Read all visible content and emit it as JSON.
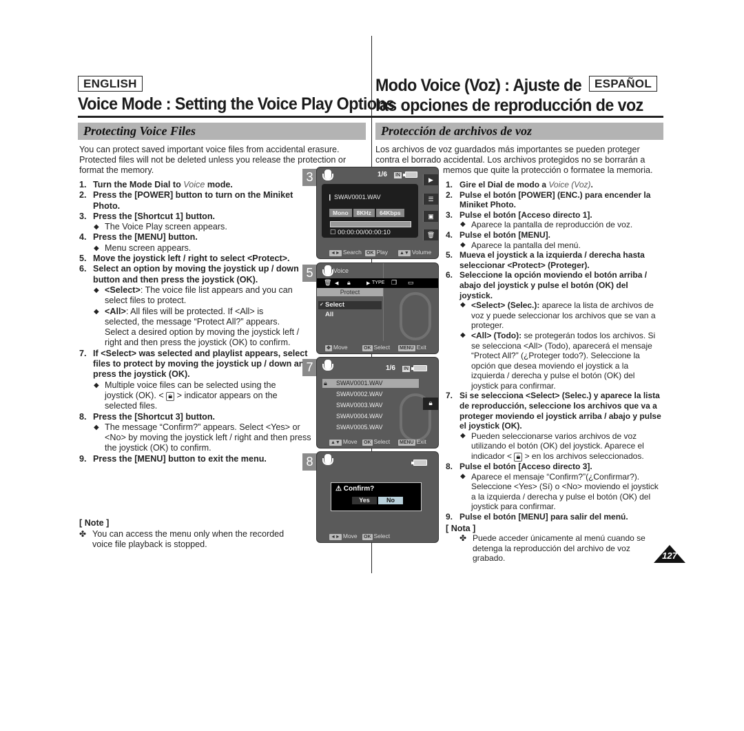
{
  "en": {
    "lang_label": "ENGLISH",
    "title": "Voice Mode : Setting the Voice Play Options",
    "section": "Protecting Voice Files",
    "intro": "You can protect saved important voice files from accidental erasure. Protected files will not be deleted unless you release the protection or format the memory.",
    "steps": [
      {
        "num": "1.",
        "text_before": "Turn the Mode Dial to ",
        "italic": "Voice",
        "text_after": " mode."
      },
      {
        "num": "2.",
        "text": "Press the [POWER] button to turn on the Miniket Photo."
      },
      {
        "num": "3.",
        "text": "Press the [Shortcut 1] button.",
        "subs": [
          "The Voice Play screen appears."
        ]
      },
      {
        "num": "4.",
        "text": "Press the [MENU] button.",
        "subs": [
          "Menu screen appears."
        ]
      },
      {
        "num": "5.",
        "text": "Move the joystick left / right to select <Protect>."
      },
      {
        "num": "6.",
        "text": "Select an option by moving the joystick up / down button and then press the joystick (OK).",
        "subs": [
          {
            "bold": "<Select>",
            "text": ": The voice file list appears and you can select files to protect."
          },
          {
            "bold": "<All>",
            "text": ": All files will be protected. If <All> is selected, the message “Protect All?” appears. Select a desired option by moving the joystick left / right and then press the joystick (OK) to confirm."
          }
        ]
      },
      {
        "num": "7.",
        "text": "If <Select> was selected and playlist appears, select files to protect by moving the joystick up / down and press the joystick (OK).",
        "subs": [
          {
            "text_before": "Multiple voice files can be selected using the joystick (OK). < ",
            "text_after": " > indicator appears on the selected files."
          }
        ]
      },
      {
        "num": "8.",
        "text": "Press the [Shortcut 3] button.",
        "subs": [
          "The message “Confirm?” appears. Select <Yes> or <No> by moving the joystick left / right and then press the joystick (OK) to confirm."
        ]
      },
      {
        "num": "9.",
        "text": "Press the [MENU] button to exit the menu."
      }
    ],
    "note_title": "[ Note ]",
    "note": "You can access the menu only when the recorded voice file playback is stopped."
  },
  "es": {
    "lang_label": "ESPAÑOL",
    "title_line1": "Modo Voice (Voz) : Ajuste de",
    "title_line2": "las opciones de reproducción de voz",
    "section": "Protección de archivos de voz",
    "intro_line1": "Los archivos de voz guardados más importantes se pueden proteger",
    "intro_line2": "contra el borrado accidental. Los archivos protegidos no se borrarán a",
    "intro_line3": "memos que quite la protección o formatee la memoria.",
    "steps": [
      {
        "num": "1.",
        "text_before": "Gire el Dial de modo a ",
        "italic": "Voice (Voz)",
        "text_after": "."
      },
      {
        "num": "2.",
        "text": "Pulse el botón [POWER] (ENC.) para encender la Miniket Photo."
      },
      {
        "num": "3.",
        "text": "Pulse el botón [Acceso directo 1].",
        "subs": [
          "Aparece la pantalla de reproducción de voz."
        ]
      },
      {
        "num": "4.",
        "text": "Pulse el botón [MENU].",
        "subs": [
          "Aparece la pantalla del menú."
        ]
      },
      {
        "num": "5.",
        "text": "Mueva el joystick a la izquierda / derecha hasta seleccionar <Protect> (Proteger)."
      },
      {
        "num": "6.",
        "text": "Seleccione la opción moviendo el botón arriba / abajo del joystick y pulse el botón (OK) del joystick.",
        "subs": [
          {
            "bold": "<Select> (Selec.):",
            "text": " aparece la lista de archivos de voz y puede seleccionar los archivos que se van a proteger."
          },
          {
            "bold": "<All> (Todo):",
            "text": " se protegerán todos los archivos. Si se selecciona <All> (Todo), aparecerá el mensaje “Protect All?” (¿Proteger todo?). Seleccione la opción que desea moviendo el joystick a la izquierda / derecha y pulse el botón (OK) del joystick para confirmar."
          }
        ]
      },
      {
        "num": "7.",
        "text": "Si se selecciona <Select> (Selec.) y aparece la lista de reproducción, seleccione los archivos que va a proteger moviendo el joystick arriba / abajo y pulse el joystick (OK).",
        "subs": [
          {
            "text_before": "Pueden seleccionarse varios archivos de voz utilizando el botón (OK) del joystick. Aparece el indicador < ",
            "text_after": " > en los archivos seleccionados."
          }
        ]
      },
      {
        "num": "8.",
        "text": "Pulse el botón [Acceso directo 3].",
        "subs": [
          "Aparece el mensaje “Confirm?”(¿Confirmar?). Seleccione <Yes> (Sí) o <No> moviendo el joystick a la izquierda / derecha y pulse el botón (OK) del joystick para confirmar."
        ]
      },
      {
        "num": "9.",
        "text": "Pulse el botón [MENU] para salir del menú."
      }
    ],
    "note_title": "[ Nota ]",
    "note": "Puede acceder únicamente al menú cuando se detenga la reproducción del archivo de voz grabado."
  },
  "screens": {
    "s3": {
      "step": "3",
      "counter": "1/6",
      "storage": "IN",
      "filename": "SWAV0001.WAV",
      "chips": [
        "Mono",
        "8KHz",
        "64Kbps"
      ],
      "progress": 0,
      "timecode": "00:00:00/00:00:10",
      "side_icons": [
        "play-icon",
        "document-icon",
        "settings-icon",
        "trash-icon"
      ],
      "footer": [
        {
          "key": "◄►",
          "label": "Search"
        },
        {
          "key": "OK",
          "label": "Play"
        },
        {
          "key": "▲▼",
          "label": "Volume"
        }
      ]
    },
    "s5": {
      "step": "5",
      "mode": "Voice",
      "menu_label": "Protect",
      "options": [
        "Select",
        "All"
      ],
      "selected": "Select",
      "footer": [
        {
          "key": "✥",
          "label": "Move"
        },
        {
          "key": "OK",
          "label": "Select"
        },
        {
          "key": "MENU",
          "label": "Exit"
        }
      ]
    },
    "s7": {
      "step": "7",
      "counter": "1/6",
      "storage": "IN",
      "files": [
        "SWAV0001.WAV",
        "SWAV0002.WAV",
        "SWAV0003.WAV",
        "SWAV0004.WAV",
        "SWAV0005.WAV"
      ],
      "footer": [
        {
          "key": "▲▼",
          "label": "Move"
        },
        {
          "key": "OK",
          "label": "Select"
        },
        {
          "key": "MENU",
          "label": "Exit"
        }
      ]
    },
    "s8": {
      "step": "8",
      "dialog_title": "Confirm?",
      "yes": "Yes",
      "no": "No",
      "footer": [
        {
          "key": "◄►",
          "label": "Move"
        },
        {
          "key": "OK",
          "label": "Select"
        }
      ]
    }
  },
  "page_number": "127"
}
